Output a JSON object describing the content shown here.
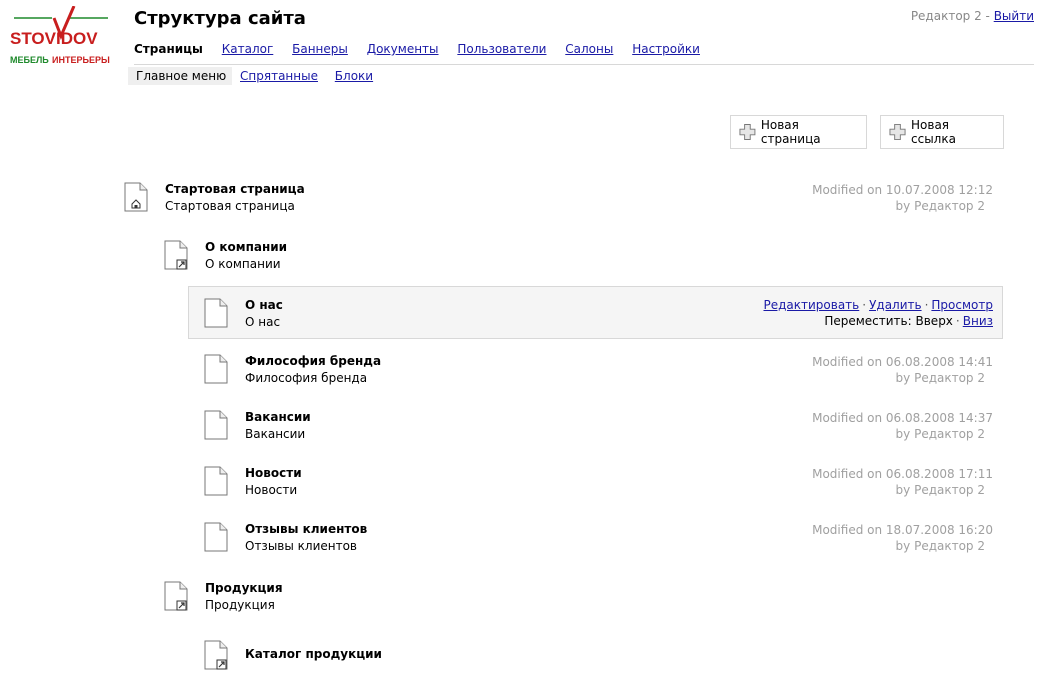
{
  "brand": {
    "logo_text_top": "STOVIDOV",
    "logo_text_bottom_left": "МЕБЕЛЬ",
    "logo_text_bottom_right": "ИНТЕРЬЕРЫ"
  },
  "header": {
    "title": "Структура сайта",
    "user": "Редактор 2",
    "separator": " - ",
    "logout": "Выйти"
  },
  "nav": {
    "items": [
      {
        "label": "Страницы"
      },
      {
        "label": "Каталог"
      },
      {
        "label": "Баннеры"
      },
      {
        "label": "Документы"
      },
      {
        "label": "Пользователи"
      },
      {
        "label": "Салоны"
      },
      {
        "label": "Настройки"
      }
    ]
  },
  "subnav": {
    "items": [
      {
        "label": "Главное меню"
      },
      {
        "label": "Спрятанные"
      },
      {
        "label": "Блоки"
      }
    ]
  },
  "buttons": {
    "new_page": "Новая страница",
    "new_link": "Новая ссылка"
  },
  "tree": [
    {
      "title": "Стартовая страница",
      "subtitle": "Стартовая страница",
      "modified": "Modified on 10.07.2008 12:12",
      "by": "by Редактор 2",
      "icon": "home-page-icon"
    },
    {
      "title": "О компании",
      "subtitle": "О компании",
      "icon": "link-page-icon"
    },
    {
      "title": "О нас",
      "subtitle": "О нас",
      "icon": "page-icon"
    },
    {
      "title": "Философия бренда",
      "subtitle": "Философия бренда",
      "modified": "Modified on 06.08.2008 14:41",
      "by": "by Редактор 2",
      "icon": "page-icon"
    },
    {
      "title": "Вакансии",
      "subtitle": "Вакансии",
      "modified": "Modified on 06.08.2008 14:37",
      "by": "by Редактор 2",
      "icon": "page-icon"
    },
    {
      "title": "Новости",
      "subtitle": "Новости",
      "modified": "Modified on 06.08.2008 17:11",
      "by": "by Редактор 2",
      "icon": "page-icon"
    },
    {
      "title": "Отзывы клиентов",
      "subtitle": "Отзывы клиентов",
      "modified": "Modified on 18.07.2008 16:20",
      "by": "by Редактор 2",
      "icon": "page-icon"
    },
    {
      "title": "Продукция",
      "subtitle": "Продукция",
      "icon": "link-page-icon"
    },
    {
      "title": "Каталог продукции",
      "icon": "link-page-icon"
    }
  ],
  "row_actions": {
    "edit": "Редактировать",
    "delete": "Удалить",
    "view": "Просмотр",
    "move_label": "Переместить:",
    "up": "Вверх",
    "down": "Вниз",
    "sep": "·"
  },
  "colors": {
    "link": "#1a1aa6",
    "brand_green": "#1f8a2c",
    "brand_red": "#c81e1e",
    "meta_gray": "#a0a0a0"
  }
}
